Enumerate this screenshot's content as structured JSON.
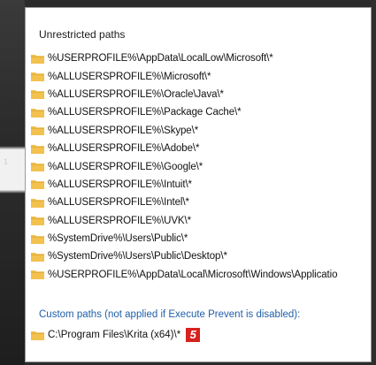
{
  "section": {
    "header": "Unrestricted paths"
  },
  "paths": [
    "%USERPROFILE%\\AppData\\LocalLow\\Microsoft\\*",
    "%ALLUSERSPROFILE%\\Microsoft\\*",
    "%ALLUSERSPROFILE%\\Oracle\\Java\\*",
    "%ALLUSERSPROFILE%\\Package Cache\\*",
    "%ALLUSERSPROFILE%\\Skype\\*",
    "%ALLUSERSPROFILE%\\Adobe\\*",
    "%ALLUSERSPROFILE%\\Google\\*",
    "%ALLUSERSPROFILE%\\Intuit\\*",
    "%ALLUSERSPROFILE%\\Intel\\*",
    "%ALLUSERSPROFILE%\\UVK\\*",
    "%SystemDrive%\\Users\\Public\\*",
    "%SystemDrive%\\Users\\Public\\Desktop\\*",
    "%USERPROFILE%\\AppData\\Local\\Microsoft\\Windows\\Applicatio"
  ],
  "custom": {
    "label": "Custom paths (not applied if Execute Prevent is disabled):",
    "path": "C:\\Program Files\\Krita (x64)\\*",
    "badge": "5"
  },
  "side_mark": "1",
  "colors": {
    "folder": "#f2c14e",
    "folder_dark": "#d9a52f",
    "custom_label": "#1f5fa8",
    "badge": "#d7211e"
  },
  "icons": {
    "folder": "folder-icon"
  }
}
